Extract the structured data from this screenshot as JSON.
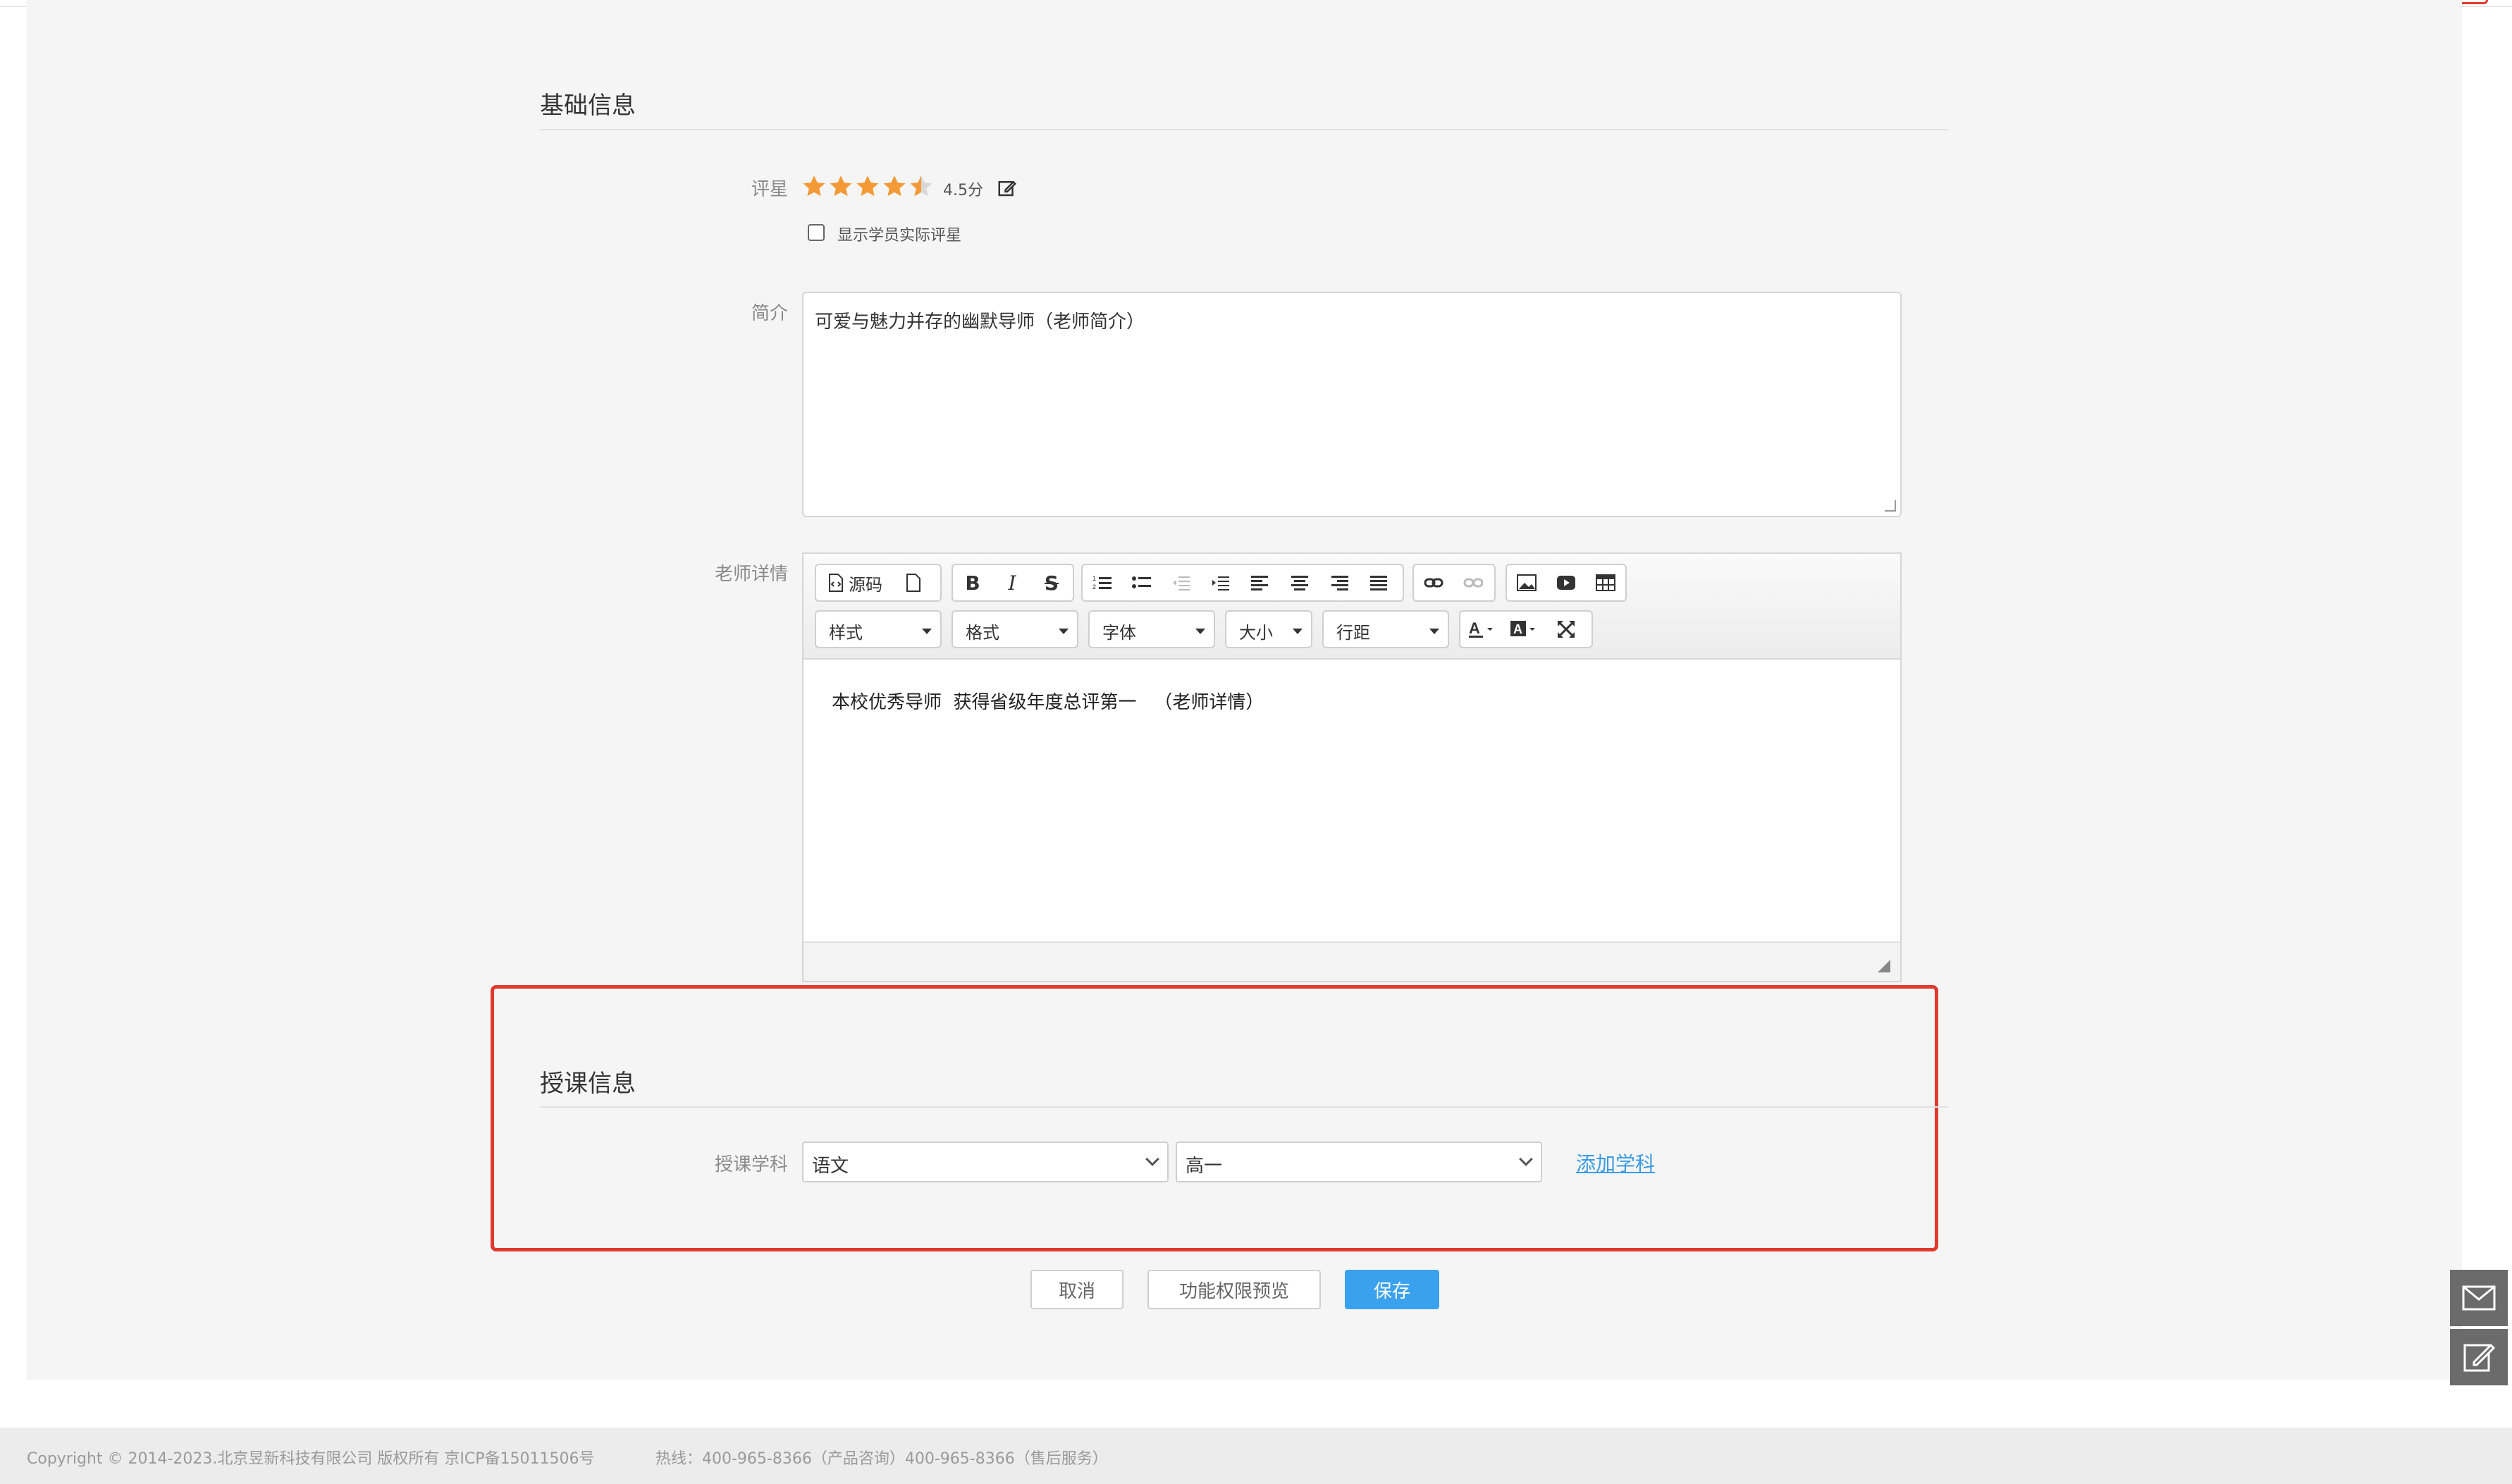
{
  "basic_section": {
    "title": "基础信息",
    "rating": {
      "label": "评星",
      "value": 4.5,
      "max": 5,
      "score_text": "4.5分"
    },
    "show_actual": {
      "label": "显示学员实际评星",
      "checked": false
    },
    "intro": {
      "label": "简介",
      "value": "可爱与魅力并存的幽默导师（老师简介）"
    },
    "details": {
      "label": "老师详情",
      "toolbar": {
        "source_label": "源码",
        "icons": [
          "source-icon",
          "new-page-icon",
          "bold-icon",
          "italic-icon",
          "strikethrough-icon",
          "ordered-list-icon",
          "unordered-list-icon",
          "outdent-icon",
          "indent-icon",
          "align-left-icon",
          "align-center-icon",
          "align-right-icon",
          "justify-icon",
          "link-icon",
          "unlink-icon",
          "image-icon",
          "video-icon",
          "table-icon",
          "text-color-icon",
          "bg-color-icon",
          "maximize-icon"
        ],
        "combos": {
          "style": "样式",
          "format": "格式",
          "font": "字体",
          "size": "大小",
          "line_height": "行距"
        }
      },
      "content": "本校优秀导师  获得省级年度总评第一   （老师详情）"
    }
  },
  "teach_section": {
    "title": "授课信息",
    "subject_label": "授课学科",
    "subject_value": "语文",
    "grade_value": "高一",
    "add_link": "添加学科"
  },
  "actions": {
    "cancel": "取消",
    "preview": "功能权限预览",
    "save": "保存"
  },
  "footer": {
    "copyright": "Copyright © 2014-2023.北京昱新科技有限公司 版权所有 京ICP备15011506号",
    "hotline": "热线：400-965-8366（产品咨询）400-965-8366（售后服务）"
  },
  "colors": {
    "accent": "#3aa1ef",
    "star": "#f39a36",
    "highlight": "#e03a2f",
    "link": "#3a9be6"
  }
}
